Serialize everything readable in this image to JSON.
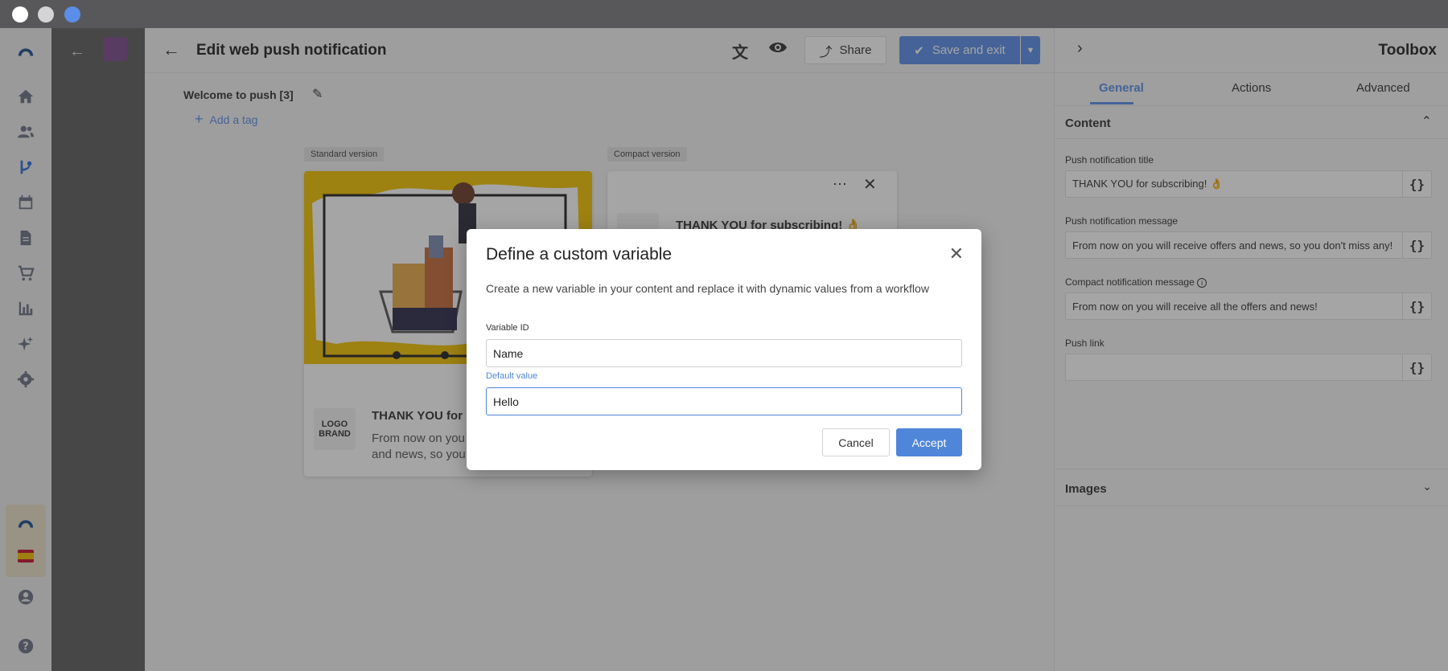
{
  "window": {
    "dots": [
      "#ffffff",
      "#d4d4d4",
      "#5b8ee8"
    ]
  },
  "rail": {
    "icons": [
      "brand-logo-icon",
      "home-icon",
      "contacts-icon",
      "workflow-icon",
      "calendar-icon",
      "document-icon",
      "cart-icon",
      "analytics-icon",
      "sparkle-icon",
      "settings-icon",
      "profile-icon",
      "help-icon"
    ]
  },
  "editor": {
    "title": "Edit web push notification",
    "share_label": "Share",
    "save_label": "Save and exit",
    "campaign_name": "Welcome to push [3]",
    "add_tag_label": "Add a tag",
    "standard_label": "Standard version",
    "compact_label": "Compact version",
    "preview_title": "THANK YOU for su",
    "preview_body_1": "From now on you",
    "preview_body_2": "and news, so you",
    "logo_line1": "LOGO",
    "logo_line2": "BRAND",
    "compact_title": "THANK YOU for subscribing! 👌"
  },
  "toolbox": {
    "title": "Toolbox",
    "tabs": [
      {
        "label": "General",
        "active": true
      },
      {
        "label": "Actions",
        "active": false
      },
      {
        "label": "Advanced",
        "active": false
      }
    ],
    "content_section": "Content",
    "fields": [
      {
        "label": "Push notification title",
        "value": "THANK YOU for subscribing! 👌",
        "var": "{}"
      },
      {
        "label": "Push notification message",
        "value": "From now on you will receive offers and news, so you don't miss any!",
        "var": "{}"
      },
      {
        "label": "Compact notification message",
        "value": "From now on you will receive all the offers and news!",
        "var": "{}"
      },
      {
        "label": "Push link",
        "value": "",
        "var": "{}"
      }
    ],
    "images_section": "Images"
  },
  "modal": {
    "title": "Define a custom variable",
    "description": "Create a new variable in your content and replace it with dynamic values from a workflow",
    "variable_id_label": "Variable ID",
    "variable_id_value": "Name",
    "default_value_label": "Default value",
    "default_value": "Hello",
    "cancel_label": "Cancel",
    "accept_label": "Accept"
  },
  "colors": {
    "accent": "#5b8ee8",
    "modal_accent": "#4f86d9"
  }
}
